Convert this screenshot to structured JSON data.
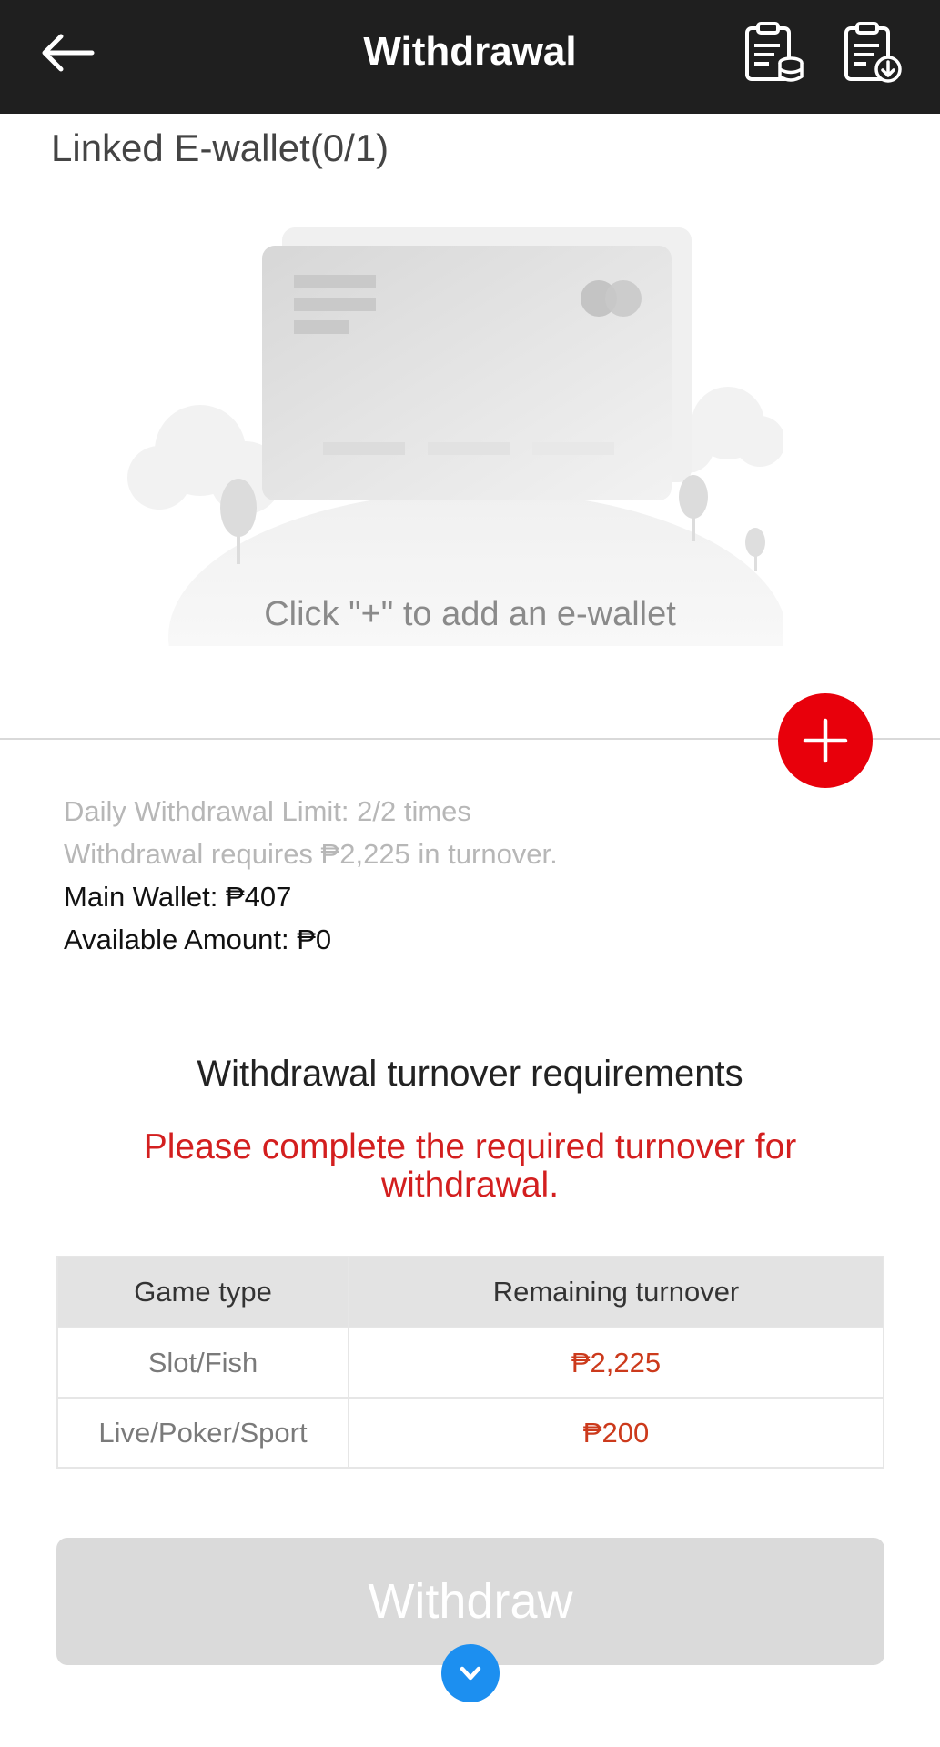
{
  "header": {
    "title": "Withdrawal",
    "back_icon": "arrow-left-icon",
    "records_icon": "clipboard-coins-icon",
    "download_icon": "clipboard-download-icon"
  },
  "ewallet": {
    "section_label": "Linked E-wallet(0/1)",
    "empty_hint": "Click \"+\" to add an e-wallet",
    "add_icon": "plus-icon"
  },
  "info": {
    "daily_limit": "Daily Withdrawal Limit: 2/2 times",
    "turnover_required": "Withdrawal requires ₱2,225 in turnover.",
    "main_wallet": "Main Wallet: ₱407",
    "available_amount": "Available Amount: ₱0"
  },
  "turnover": {
    "title": "Withdrawal turnover requirements",
    "warning": "Please complete the required turnover for withdrawal.",
    "headers": [
      "Game type",
      "Remaining turnover"
    ],
    "rows": [
      {
        "type": "Slot/Fish",
        "amount": "₱2,225"
      },
      {
        "type": "Live/Poker/Sport",
        "amount": "₱200"
      }
    ]
  },
  "actions": {
    "withdraw_label": "Withdraw",
    "scroll_icon": "chevron-down-icon"
  },
  "colors": {
    "header_bg": "#1f1f1f",
    "accent_red": "#e8000b",
    "warning_red": "#d31f1f",
    "amount_red": "#cc3a1c",
    "scroll_blue": "#1c8ff0"
  }
}
